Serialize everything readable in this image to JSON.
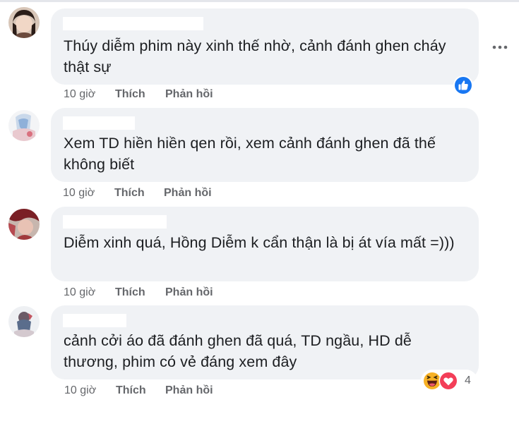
{
  "comments": [
    {
      "text": "Thúy diễm phim này xinh thế nhờ, cảnh đánh ghen cháy thật sự",
      "time": "10 giờ",
      "like_label": "Thích",
      "reply_label": "Phản hồi",
      "reactions": [
        "like-icon"
      ]
    },
    {
      "text": "Xem TD hiền hiền qen rồi, xem cảnh đánh ghen đã thế không biết",
      "time": "10 giờ",
      "like_label": "Thích",
      "reply_label": "Phản hồi"
    },
    {
      "text": "Diễm xinh quá, Hồng Diễm k cẩn thận là bị át vía mất =)))",
      "time": "10 giờ",
      "like_label": "Thích",
      "reply_label": "Phản hồi"
    },
    {
      "text": "cảnh cởi áo đã đánh ghen đã quá, TD ngầu, HD dễ thương, phim có vẻ đáng xem đây",
      "time": "10 giờ",
      "like_label": "Thích",
      "reply_label": "Phản hồi",
      "reactions": [
        "haha-icon",
        "love-icon"
      ],
      "reaction_count": "4"
    }
  ],
  "colors": {
    "bubble": "#f0f2f5",
    "text": "#1c1e21",
    "meta": "#65676b",
    "like_blue": "#1877f2",
    "love_red": "#f33e58",
    "haha_yellow": "#f7b125"
  }
}
